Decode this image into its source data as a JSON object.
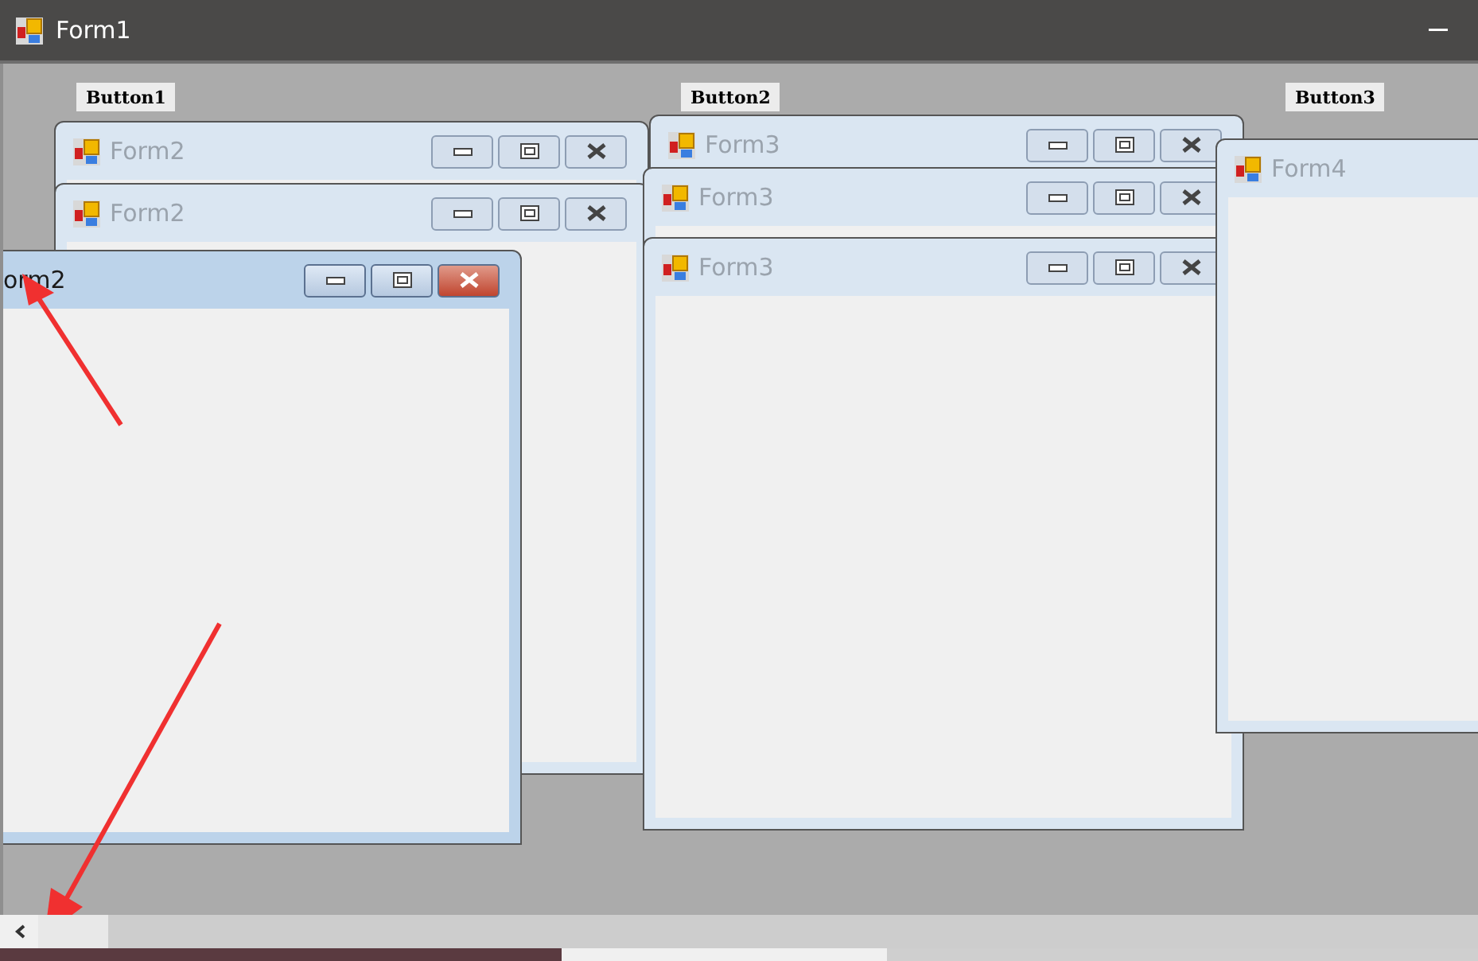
{
  "window": {
    "title": "Form1"
  },
  "buttons": [
    "Button1",
    "Button2",
    "Button3"
  ],
  "child_windows": [
    {
      "title": "Form2",
      "active": false,
      "icon": true,
      "caption_buttons": true
    },
    {
      "title": "Form2",
      "active": false,
      "icon": true,
      "caption_buttons": true
    },
    {
      "title": "Form3",
      "active": false,
      "icon": true,
      "caption_buttons": true
    },
    {
      "title": "Form3",
      "active": false,
      "icon": true,
      "caption_buttons": true
    },
    {
      "title": "Form3",
      "active": false,
      "icon": true,
      "caption_buttons": true
    },
    {
      "title": "Form4",
      "active": false,
      "icon": true,
      "caption_buttons": false
    },
    {
      "title": "orm2",
      "active": true,
      "icon": false,
      "caption_buttons": true
    }
  ]
}
